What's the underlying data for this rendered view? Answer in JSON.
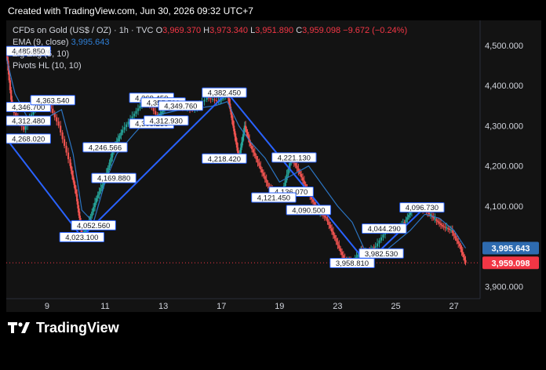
{
  "header": {
    "created_text": "Created with TradingView.com, Jun 30, 2026 09:32 UTC+7"
  },
  "legend": {
    "symbol": "CFDs on Gold (US$ / OZ) · 1h · TVC",
    "open_label": "O",
    "open": "3,969.370",
    "high_label": "H",
    "high": "3,973.340",
    "low_label": "L",
    "low": "3,951.890",
    "close_label": "C",
    "close": "3,959.098",
    "change": "−9.672 (−0.24%)",
    "ema_label": "EMA (9, close)",
    "ema_value": "3,995.643",
    "zigzag_label": "Zig Zag (5, 10)",
    "pivots_label": "Pivots HL (10, 10)"
  },
  "footer": {
    "brand": "TradingView"
  },
  "colors": {
    "up": "#26a69a",
    "down": "#ef5350",
    "ema": "#2f7fd6",
    "zigzag": "#2962ff",
    "price_tag": "#f23645",
    "ema_tag": "#2e6bb0"
  },
  "chart_data": {
    "type": "line",
    "title": "CFDs on Gold (US$ / OZ) · 1h · TVC",
    "x_tick_labels": [
      "9",
      "11",
      "13",
      "17",
      "19",
      "23",
      "25",
      "27"
    ],
    "x_ticks": [
      9,
      11,
      13,
      15,
      17,
      19,
      21,
      23
    ],
    "xlim": [
      7.6,
      23.9
    ],
    "y_tick_labels": [
      "3,900.000",
      "4,000.000",
      "4,100.000",
      "4,200.000",
      "4,300.000",
      "4,400.000",
      "4,500.000"
    ],
    "y_ticks": [
      3900,
      4000,
      4100,
      4200,
      4300,
      4400,
      4500
    ],
    "ylim": [
      3870,
      4562
    ],
    "grid": false,
    "series": [
      {
        "name": "Zig Zag (5, 10)",
        "x": [
          7.6,
          10.2,
          15.2,
          20.0,
          22.0
        ],
        "y": [
          4268.02,
          4023.1,
          4382.45,
          3958.81,
          4096.73
        ]
      },
      {
        "name": "EMA (9, close)",
        "x": [
          7.6,
          7.9,
          8.4,
          9.0,
          9.5,
          9.9,
          10.2,
          10.6,
          11.0,
          11.4,
          12.0,
          12.5,
          13.0,
          13.6,
          14.3,
          14.8,
          15.2,
          15.6,
          16.0,
          16.5,
          17.0,
          17.5,
          18.0,
          18.5,
          19.0,
          19.5,
          20.0,
          20.5,
          21.0,
          21.5,
          22.0,
          22.5,
          23.0,
          23.4
        ],
        "y": [
          4470,
          4380,
          4310,
          4320,
          4340,
          4230,
          4090,
          4060,
          4160,
          4230,
          4280,
          4320,
          4330,
          4340,
          4345,
          4350,
          4360,
          4300,
          4260,
          4220,
          4160,
          4180,
          4200,
          4150,
          4100,
          4060,
          3980,
          3980,
          4010,
          4040,
          4080,
          4070,
          4040,
          3995.643
        ]
      },
      {
        "name": "Price",
        "x": [
          7.6,
          7.8,
          8.2,
          8.6,
          9.0,
          9.4,
          9.8,
          10.0,
          10.2,
          10.4,
          10.7,
          11.0,
          11.3,
          11.6,
          12.0,
          12.4,
          12.8,
          13.1,
          13.5,
          14.0,
          14.5,
          14.9,
          15.2,
          15.4,
          15.6,
          15.8,
          16.0,
          16.3,
          16.6,
          16.9,
          17.1,
          17.4,
          17.7,
          18.0,
          18.3,
          18.6,
          18.9,
          19.2,
          19.5,
          19.8,
          20.0,
          20.3,
          20.7,
          21.0,
          21.3,
          21.6,
          22.0,
          22.3,
          22.6,
          22.9,
          23.2,
          23.4
        ],
        "y": [
          4485.85,
          4340,
          4290,
          4346.7,
          4363.54,
          4300,
          4200,
          4130,
          4023.1,
          4052.56,
          4120,
          4169.88,
          4246.57,
          4290,
          4330,
          4369.45,
          4320,
          4350,
          4349.76,
          4340,
          4370,
          4360,
          4382.45,
          4300,
          4218.42,
          4300,
          4250,
          4200,
          4150,
          4121.45,
          4136.07,
          4221.13,
          4180,
          4130,
          4090.5,
          4070,
          4020,
          3970,
          3958.81,
          3990,
          3982.53,
          4000,
          4044.29,
          4040,
          4060,
          4096.73,
          4090,
          4070,
          4050,
          4040,
          4000,
          3959.098
        ]
      }
    ],
    "pivot_labels": [
      {
        "text": "4,485.850",
        "x": 7.6,
        "y": 4485.85
      },
      {
        "text": "4,346.700",
        "x": 8.0,
        "y": 4346.7
      },
      {
        "text": "4,363.540",
        "x": 9.2,
        "y": 4363.54
      },
      {
        "text": "4,312.480",
        "x": 8.2,
        "y": 4312.48
      },
      {
        "text": "4,268.020",
        "x": 7.6,
        "y": 4268.02
      },
      {
        "text": "4,023.100",
        "x": 10.2,
        "y": 4023.1
      },
      {
        "text": "4,052.560",
        "x": 10.6,
        "y": 4052.56
      },
      {
        "text": "4,169.880",
        "x": 11.3,
        "y": 4169.88
      },
      {
        "text": "4,246.566",
        "x": 11.0,
        "y": 4246.566
      },
      {
        "text": "4,369.450",
        "x": 12.6,
        "y": 4369.45
      },
      {
        "text": "4,357.780",
        "x": 13.0,
        "y": 4357.78
      },
      {
        "text": "4,349.760",
        "x": 13.6,
        "y": 4349.76
      },
      {
        "text": "4,305.230",
        "x": 12.6,
        "y": 4305.23
      },
      {
        "text": "4,312.930",
        "x": 13.1,
        "y": 4312.93
      },
      {
        "text": "4,382.450",
        "x": 15.1,
        "y": 4382.45
      },
      {
        "text": "4,218.420",
        "x": 15.1,
        "y": 4218.42
      },
      {
        "text": "4,221.130",
        "x": 17.5,
        "y": 4221.13
      },
      {
        "text": "4,136.070",
        "x": 17.4,
        "y": 4136.07
      },
      {
        "text": "4,121.450",
        "x": 16.8,
        "y": 4121.45
      },
      {
        "text": "4,090.500",
        "x": 18.0,
        "y": 4090.5
      },
      {
        "text": "4,096.730",
        "x": 21.9,
        "y": 4096.73
      },
      {
        "text": "4,044.290",
        "x": 20.6,
        "y": 4044.29
      },
      {
        "text": "3,982.530",
        "x": 20.5,
        "y": 3982.53
      },
      {
        "text": "3,958.810",
        "x": 19.5,
        "y": 3958.81
      }
    ],
    "price_tags": [
      {
        "text": "3,995.643",
        "y": 3995.643,
        "color": "#2e6bb0"
      },
      {
        "text": "3,959.098",
        "y": 3959.098,
        "color": "#f23645"
      }
    ]
  }
}
